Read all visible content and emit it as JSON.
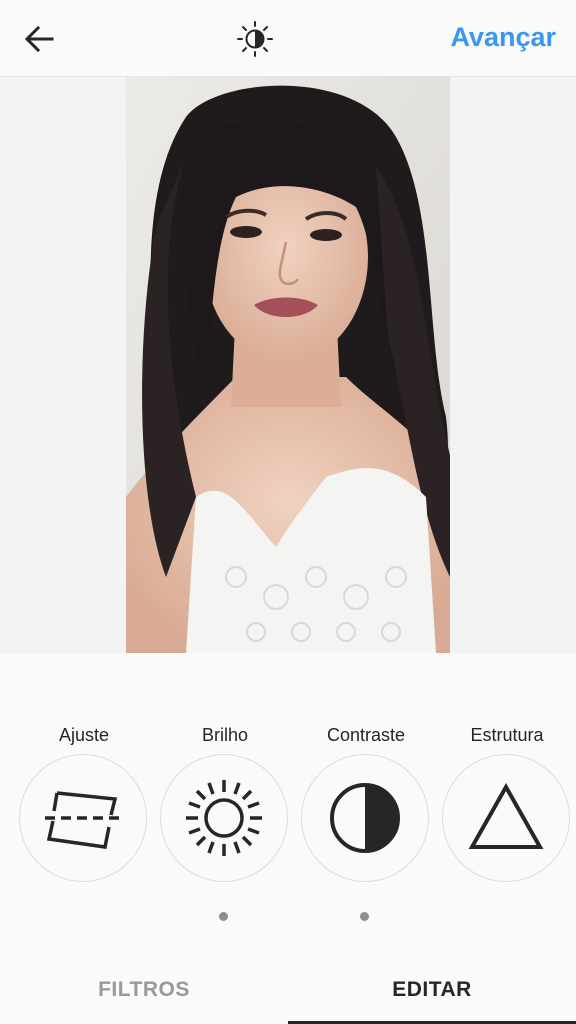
{
  "header": {
    "back_icon": "back-arrow-icon",
    "lux_icon": "lux-icon",
    "next_label": "Avançar",
    "accent_color": "#3897f0"
  },
  "photo": {
    "description_icon": "selfie-photo"
  },
  "tools": [
    {
      "label": "Ajuste",
      "icon": "adjust-icon"
    },
    {
      "label": "Brilho",
      "icon": "brightness-icon"
    },
    {
      "label": "Contraste",
      "icon": "contrast-icon"
    },
    {
      "label": "Estrutura",
      "icon": "structure-icon"
    }
  ],
  "tabs": {
    "filters_label": "FILTROS",
    "edit_label": "EDITAR",
    "active": "EDITAR"
  }
}
